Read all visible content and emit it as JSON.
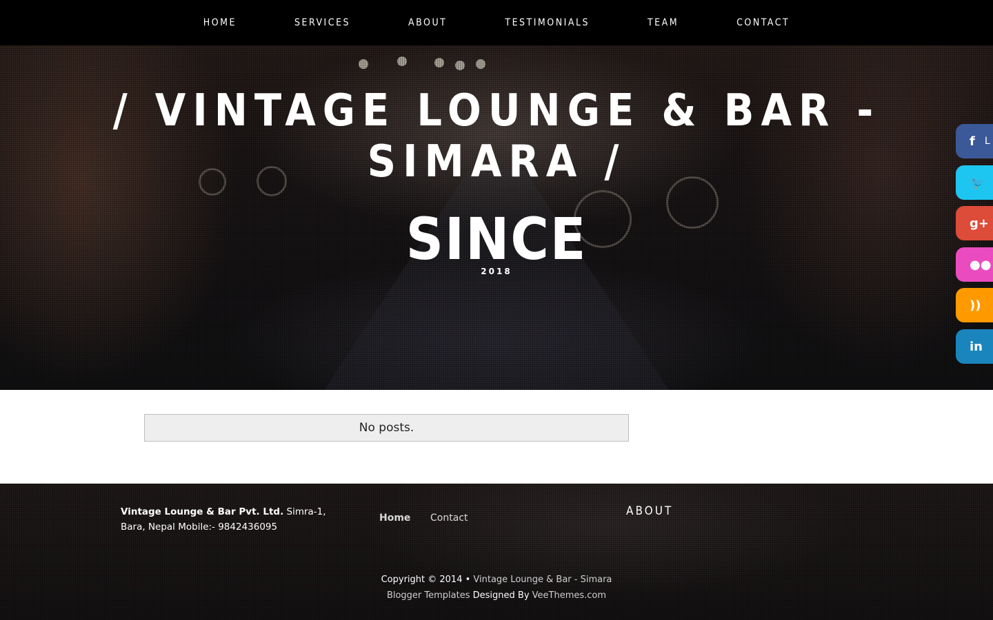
{
  "nav": {
    "items": [
      {
        "label": "HOME"
      },
      {
        "label": "SERVICES"
      },
      {
        "label": "ABOUT"
      },
      {
        "label": "TESTIMONIALS"
      },
      {
        "label": "TEAM"
      },
      {
        "label": "CONTACT"
      }
    ]
  },
  "hero": {
    "title": "/ VINTAGE LOUNGE & BAR - SIMARA /",
    "since": "SINCE",
    "year": "2018"
  },
  "social": [
    {
      "icon": "facebook-icon",
      "glyph": "f",
      "color": "#3b5998",
      "extra": "L"
    },
    {
      "icon": "twitter-icon",
      "glyph": "🐦",
      "color": "#1dc6f0",
      "extra": ""
    },
    {
      "icon": "google-plus-icon",
      "glyph": "g+",
      "color": "#dd4b39",
      "extra": ""
    },
    {
      "icon": "flickr-icon",
      "glyph": "●●",
      "color": "#ea4cc0",
      "extra": ""
    },
    {
      "icon": "rss-icon",
      "glyph": "))",
      "color": "#ff9900",
      "extra": ""
    },
    {
      "icon": "linkedin-icon",
      "glyph": "in",
      "color": "#1a85bc",
      "extra": ""
    }
  ],
  "main": {
    "no_posts": "No posts."
  },
  "footer": {
    "company_name": "Vintage Lounge & Bar Pvt. Ltd.",
    "company_address": " Simra-1, Bara, Nepal Mobile:- 9842436095",
    "links": [
      {
        "label": "Home"
      },
      {
        "label": "Contact"
      }
    ],
    "about_heading": "ABOUT",
    "copyright_prefix": "Copyright © 2014 • ",
    "site_link": "Vintage Lounge & Bar - Simara",
    "templates_link": "Blogger Templates",
    "designed_by": " Designed By ",
    "designer_link": "VeeThemes.com"
  }
}
